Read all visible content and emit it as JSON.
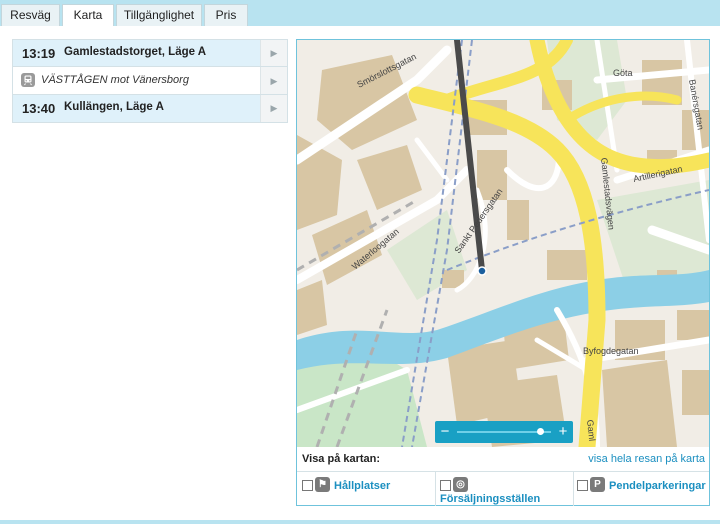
{
  "tabs": [
    {
      "label": "Resväg",
      "active": false
    },
    {
      "label": "Karta",
      "active": true
    },
    {
      "label": "Tillgänglighet",
      "active": false
    },
    {
      "label": "Pris",
      "active": false
    }
  ],
  "journey": [
    {
      "type": "stop",
      "time": "13:19",
      "name": "Gamlestadstorget, Läge A"
    },
    {
      "type": "train",
      "icon": "train-icon",
      "name": "VÄSTTÅGEN mot Vänersborg"
    },
    {
      "type": "stop",
      "time": "13:40",
      "name": "Kullängen, Läge A"
    }
  ],
  "map": {
    "street_labels": [
      "Smörslottsgatan",
      "Göta",
      "Banérsgatan",
      "Artillerigatan",
      "Gamlestadsvägen",
      "Waterloogatan",
      "Sankt Pedersgatan",
      "Byfogdegatan",
      "Gaml"
    ],
    "zoom": {
      "minus_label": "−",
      "plus_label": "+",
      "level": 0.88
    }
  },
  "layers": {
    "title": "Visa på kartan:",
    "link": "visa hela resan på karta",
    "options": [
      {
        "label": "Hållplatser",
        "icon": "bus-stop-icon",
        "checked": false
      },
      {
        "label": "Försäljningsställen",
        "icon": "ticket-sales-icon",
        "checked": false
      },
      {
        "label": "Pendelparkeringar",
        "icon": "parking-icon",
        "checked": false
      }
    ]
  },
  "colors": {
    "accent": "#19a0c4",
    "road_major": "#f7e45a",
    "water": "#8ccfe6",
    "park": "#c9e6c7",
    "building": "#d8c6a4",
    "route": "#4a4a4a",
    "background": "#b8e3f0"
  }
}
